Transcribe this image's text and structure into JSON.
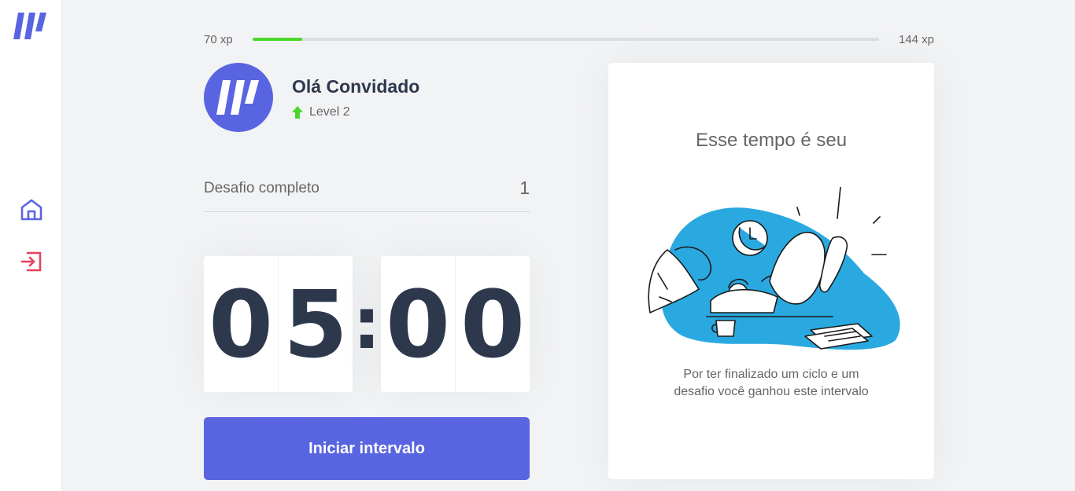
{
  "app": {
    "logo_icon": "moveit-logo-icon",
    "nav": [
      {
        "name": "home",
        "icon": "home-icon",
        "color": "#5965e0"
      },
      {
        "name": "logout",
        "icon": "logout-icon",
        "color": "#e83f5b"
      }
    ]
  },
  "xp": {
    "current_label": "70 xp",
    "next_label": "144 xp",
    "progress_fraction": 0.08
  },
  "profile": {
    "name": "Olá Convidado",
    "level_label": "Level 2",
    "level_icon": "level-up-arrow-icon"
  },
  "completed": {
    "label": "Desafio completo",
    "count": "1"
  },
  "countdown": {
    "minutes_left": "0",
    "minutes_right": "5",
    "separator": ":",
    "seconds_left": "0",
    "seconds_right": "0"
  },
  "button": {
    "start_label": "Iniciar intervalo"
  },
  "card": {
    "title": "Esse tempo é seu",
    "illustration_icon": "resting-person-illustration",
    "message": "Por ter finalizado um ciclo e um desafio você ganhou este intervalo"
  },
  "colors": {
    "primary": "#5965e0",
    "progress_green": "#4cd62b",
    "danger": "#e83f5b",
    "title_dark": "#2e384d",
    "illustration_blue": "#2aa9e0"
  }
}
